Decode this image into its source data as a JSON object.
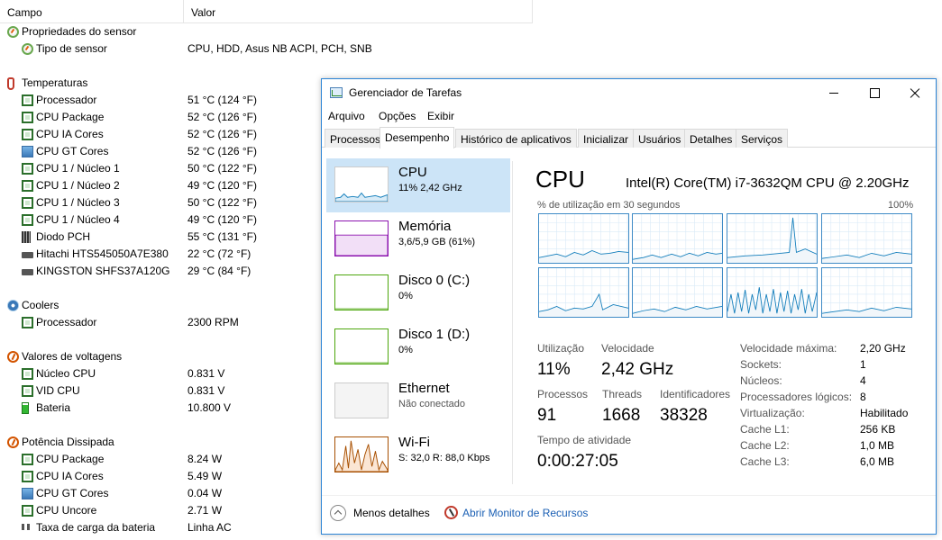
{
  "sensor_app": {
    "columns": {
      "field": "Campo",
      "value": "Valor"
    },
    "rows": [
      {
        "label": "Propriedades do sensor",
        "value": "",
        "indent": 0,
        "icon": "gauge-icon"
      },
      {
        "label": "Tipo de sensor",
        "value": "CPU, HDD, Asus NB ACPI, PCH, SNB",
        "indent": 1,
        "icon": "gauge-icon"
      },
      {
        "label": "Temperaturas",
        "value": "",
        "indent": 0,
        "icon": "thermometer-icon"
      },
      {
        "label": "Processador",
        "value": "51 °C  (124 °F)",
        "indent": 1,
        "icon": "chip-icon"
      },
      {
        "label": "CPU Package",
        "value": "52 °C  (126 °F)",
        "indent": 1,
        "icon": "chip-icon"
      },
      {
        "label": "CPU IA Cores",
        "value": "52 °C  (126 °F)",
        "indent": 1,
        "icon": "chip-icon"
      },
      {
        "label": "CPU GT Cores",
        "value": "52 °C  (126 °F)",
        "indent": 1,
        "icon": "gpu-icon"
      },
      {
        "label": "CPU 1 / Núcleo 1",
        "value": "50 °C  (122 °F)",
        "indent": 1,
        "icon": "chip-icon"
      },
      {
        "label": "CPU 1 / Núcleo 2",
        "value": "49 °C  (120 °F)",
        "indent": 1,
        "icon": "chip-icon"
      },
      {
        "label": "CPU 1 / Núcleo 3",
        "value": "50 °C  (122 °F)",
        "indent": 1,
        "icon": "chip-icon"
      },
      {
        "label": "CPU 1 / Núcleo 4",
        "value": "49 °C  (120 °F)",
        "indent": 1,
        "icon": "chip-icon"
      },
      {
        "label": "Diodo PCH",
        "value": "55 °C  (131 °F)",
        "indent": 1,
        "icon": "diode-icon"
      },
      {
        "label": "Hitachi HTS545050A7E380",
        "value": "22 °C  (72 °F)",
        "indent": 1,
        "icon": "drive-icon"
      },
      {
        "label": "KINGSTON SHFS37A120G",
        "value": "29 °C  (84 °F)",
        "indent": 1,
        "icon": "drive-icon"
      },
      {
        "label": "Coolers",
        "value": "",
        "indent": 0,
        "icon": "fan-icon"
      },
      {
        "label": "Processador",
        "value": "2300 RPM",
        "indent": 1,
        "icon": "chip-icon"
      },
      {
        "label": "Valores de voltagens",
        "value": "",
        "indent": 0,
        "icon": "voltmeter-icon"
      },
      {
        "label": "Núcleo CPU",
        "value": "0.831 V",
        "indent": 1,
        "icon": "chip-icon"
      },
      {
        "label": "VID CPU",
        "value": "0.831 V",
        "indent": 1,
        "icon": "chip-icon"
      },
      {
        "label": "Bateria",
        "value": "10.800 V",
        "indent": 1,
        "icon": "battery-icon"
      },
      {
        "label": "Potência Dissipada",
        "value": "",
        "indent": 0,
        "icon": "voltmeter-icon"
      },
      {
        "label": "CPU Package",
        "value": "8.24 W",
        "indent": 1,
        "icon": "chip-icon"
      },
      {
        "label": "CPU IA Cores",
        "value": "5.49 W",
        "indent": 1,
        "icon": "chip-icon"
      },
      {
        "label": "CPU GT Cores",
        "value": "0.04 W",
        "indent": 1,
        "icon": "gpu-icon"
      },
      {
        "label": "CPU Uncore",
        "value": "2.71 W",
        "indent": 1,
        "icon": "chip-icon"
      },
      {
        "label": "Taxa de carga da bateria",
        "value": "Linha AC",
        "indent": 1,
        "icon": "plug-icon"
      }
    ]
  },
  "taskmgr": {
    "title": "Gerenciador de Tarefas",
    "menu": [
      "Arquivo",
      "Opções",
      "Exibir"
    ],
    "tabs": [
      "Processos",
      "Desempenho",
      "Histórico de aplicativos",
      "Inicializar",
      "Usuários",
      "Detalhes",
      "Serviços"
    ],
    "active_tab": "Desempenho",
    "resources": [
      {
        "name": "CPU",
        "sub": "11% 2,42 GHz",
        "color": "#117dbb"
      },
      {
        "name": "Memória",
        "sub": "3,6/5,9 GB (61%)",
        "color": "#8b12ae"
      },
      {
        "name": "Disco 0 (C:)",
        "sub": "0%",
        "color": "#4da60c"
      },
      {
        "name": "Disco 1 (D:)",
        "sub": "0%",
        "color": "#4da60c"
      },
      {
        "name": "Ethernet",
        "sub": "Não conectado",
        "color": "#a74f01"
      },
      {
        "name": "Wi-Fi",
        "sub": "S: 32,0  R: 88,0 Kbps",
        "color": "#a74f01"
      }
    ],
    "cpu": {
      "title": "CPU",
      "model": "Intel(R) Core(TM) i7-3632QM CPU @ 2.20GHz",
      "graph_caption": "% de utilização em 30 segundos",
      "graph_max": "100%",
      "graph_color": "#117dbb",
      "stats": {
        "util_label": "Utilização",
        "util_value": "11%",
        "speed_label": "Velocidade",
        "speed_value": "2,42 GHz",
        "proc_label": "Processos",
        "proc_value": "91",
        "threads_label": "Threads",
        "threads_value": "1668",
        "handles_label": "Identificadores",
        "handles_value": "38328",
        "uptime_label": "Tempo de atividade",
        "uptime_value": "0:00:27:05"
      },
      "details": [
        {
          "label": "Velocidade máxima:",
          "value": "2,20 GHz"
        },
        {
          "label": "Sockets:",
          "value": "1"
        },
        {
          "label": "Núcleos:",
          "value": "4"
        },
        {
          "label": "Processadores lógicos:",
          "value": "8"
        },
        {
          "label": "Virtualização:",
          "value": "Habilitado"
        },
        {
          "label": "Cache L1:",
          "value": "256 KB"
        },
        {
          "label": "Cache L2:",
          "value": "1,0 MB"
        },
        {
          "label": "Cache L3:",
          "value": "6,0 MB"
        }
      ]
    },
    "footer": {
      "fewer_details": "Menos detalhes",
      "open_monitor": "Abrir Monitor de Recursos"
    }
  }
}
